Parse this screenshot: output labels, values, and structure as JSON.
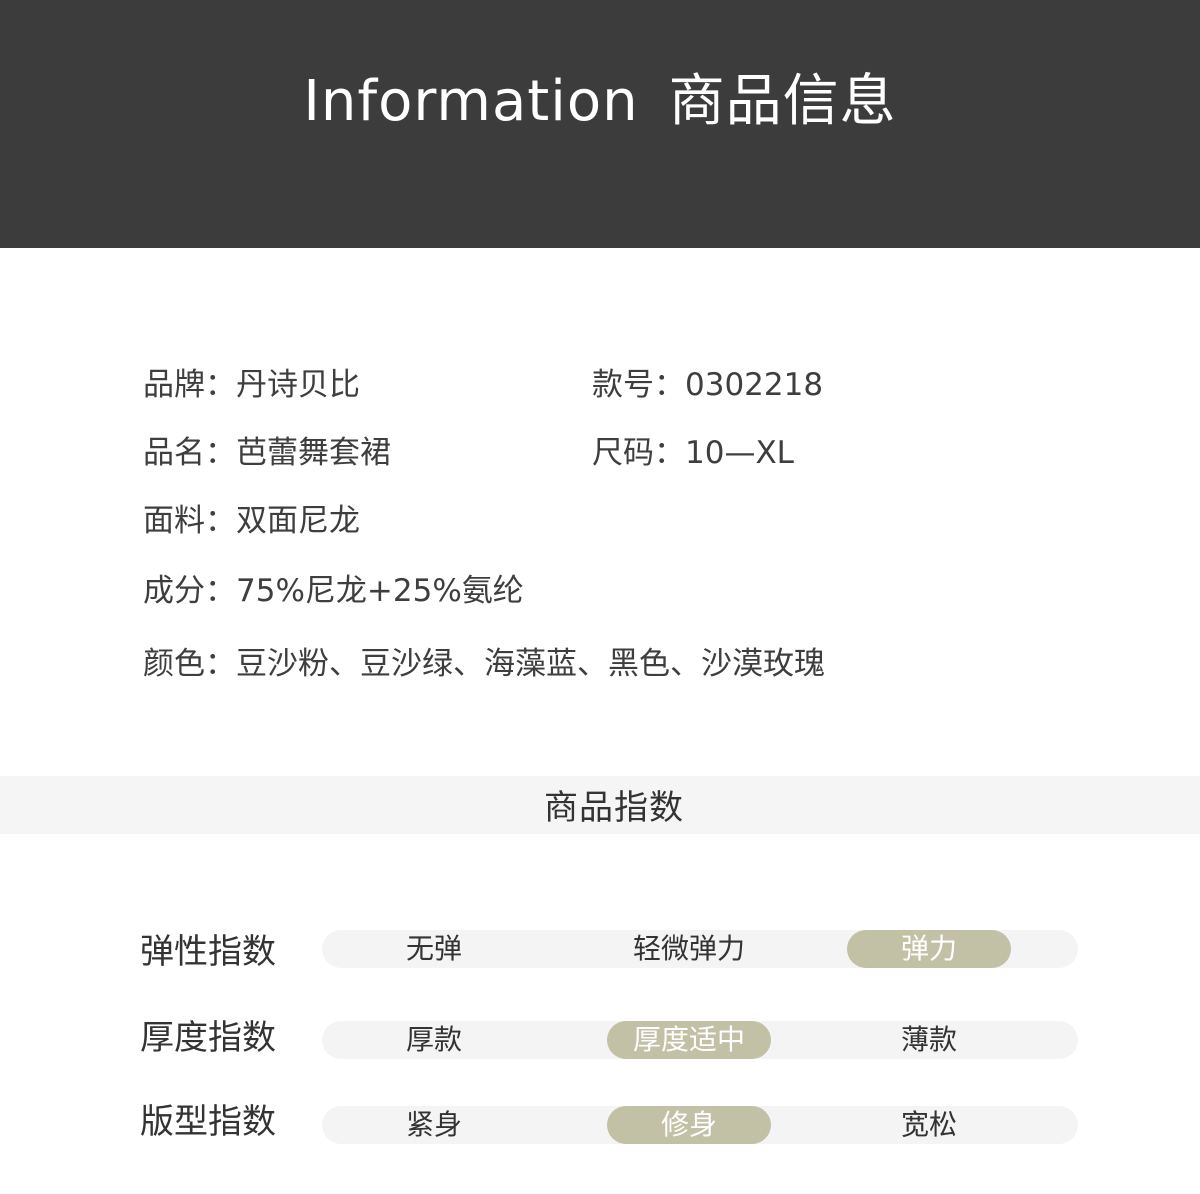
{
  "header": {
    "title_en": "Information",
    "title_cn": "商品信息"
  },
  "info": {
    "brand": "品牌：丹诗贝比",
    "style_no": "款号：0302218",
    "product_name": "品名：芭蕾舞套裙",
    "size": "尺码：10—XL",
    "fabric": "面料：双面尼龙",
    "composition": "成分：75%尼龙+25%氨纶",
    "colors": "颜色：豆沙粉、豆沙绿、海藻蓝、黑色、沙漠玫瑰"
  },
  "index_section": {
    "title": "商品指数",
    "selected_color": "#c2c1a5",
    "rows": [
      {
        "label": "弹性指数",
        "options": [
          "无弹",
          "轻微弹力",
          "弹力"
        ],
        "selected": "弹力"
      },
      {
        "label": "厚度指数",
        "options": [
          "厚款",
          "厚度适中",
          "薄款"
        ],
        "selected": "厚度适中"
      },
      {
        "label": "版型指数",
        "options": [
          "紧身",
          "修身",
          "宽松"
        ],
        "selected": "修身"
      }
    ]
  }
}
